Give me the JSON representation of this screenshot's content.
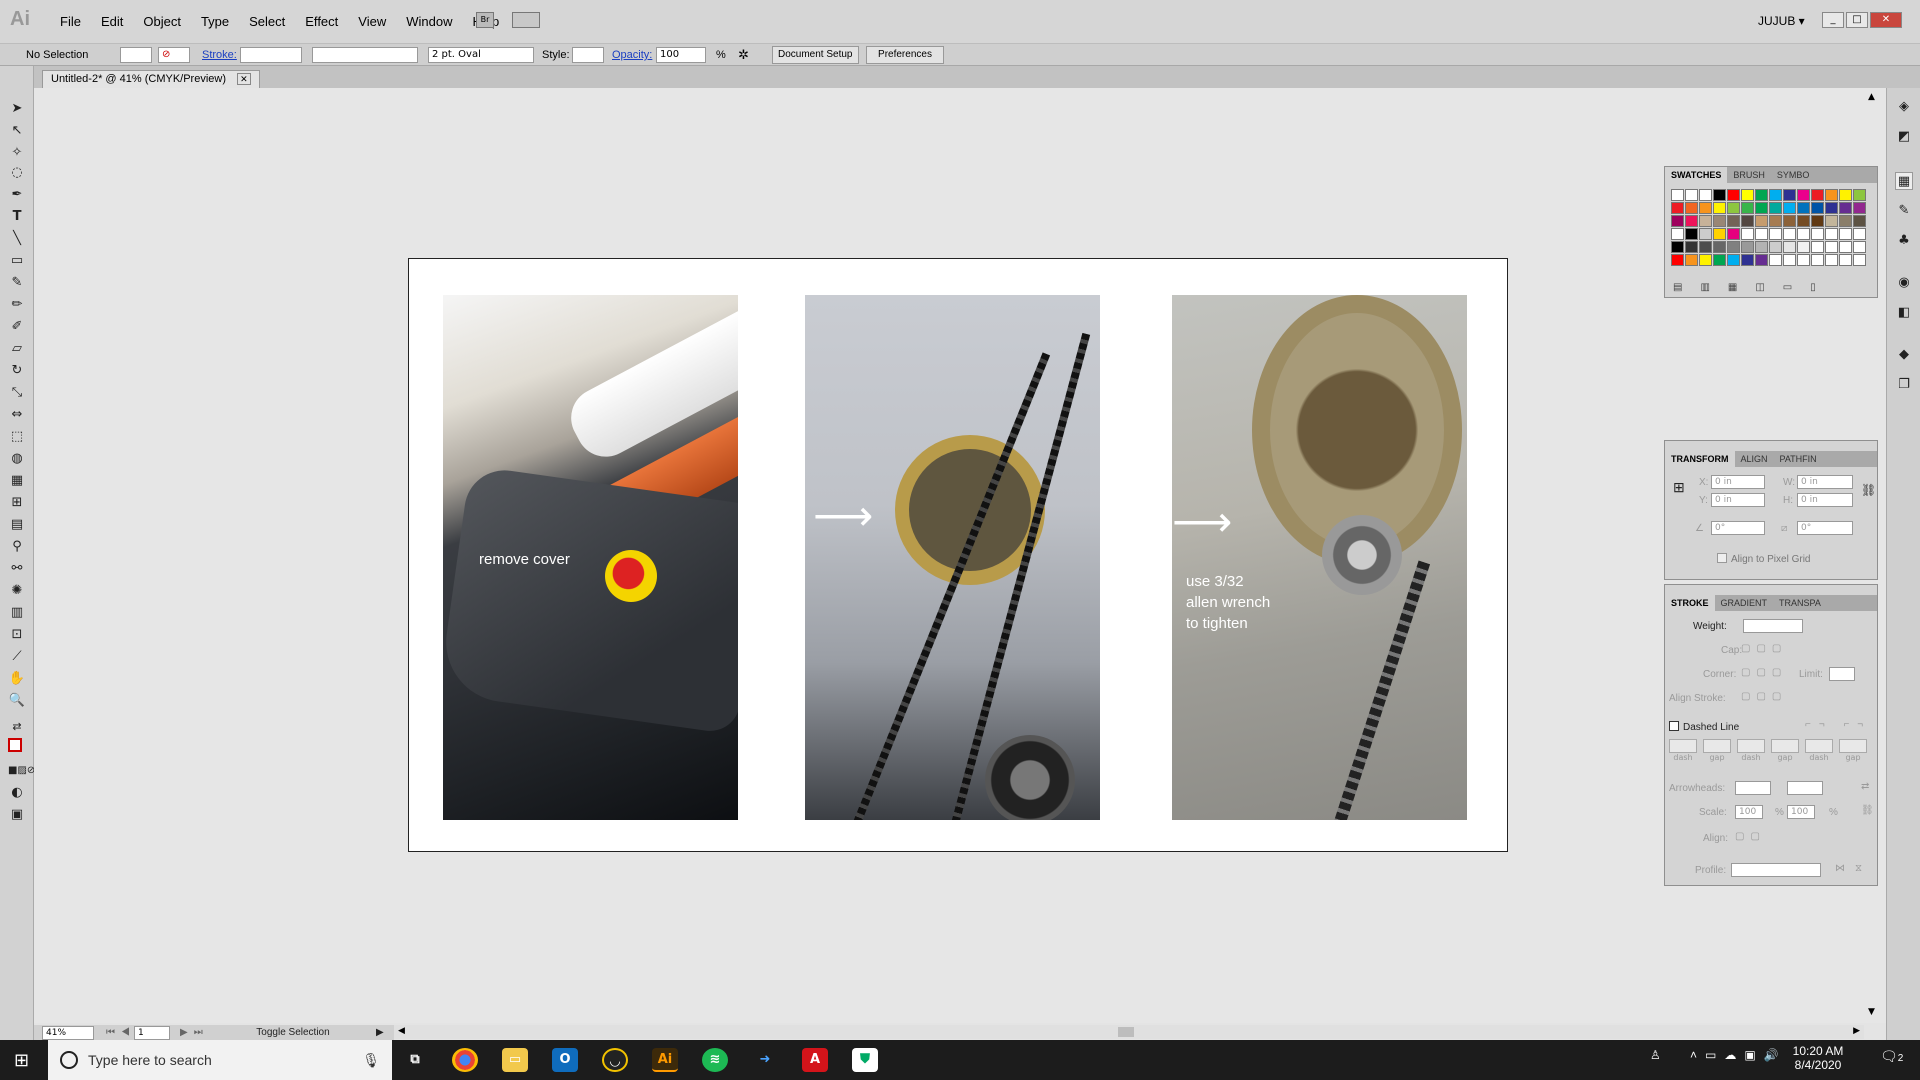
{
  "app": {
    "logo": "Ai",
    "menu": [
      "File",
      "Edit",
      "Object",
      "Type",
      "Select",
      "Effect",
      "View",
      "Window",
      "Help"
    ],
    "bridge_label": "Br",
    "user": "JUJUB"
  },
  "control_bar": {
    "selection": "No Selection",
    "stroke_label": "Stroke:",
    "brush": "2 pt. Oval",
    "style_label": "Style:",
    "opacity_label": "Opacity:",
    "opacity_value": "100",
    "opacity_unit": "%",
    "document_setup": "Document Setup",
    "preferences": "Preferences"
  },
  "document": {
    "tab_title": "Untitled-2* @ 41% (CMYK/Preview)"
  },
  "artboard": {
    "captions": {
      "photo1": "remove cover",
      "photo3_line1": "use 3/32",
      "photo3_line2": "allen wrench",
      "photo3_line3": "to tighten"
    }
  },
  "panels": {
    "swatches_tabs": [
      "SWATCHES",
      "BRUSH",
      "SYMBO"
    ],
    "transform_tabs": [
      "TRANSFORM",
      "ALIGN",
      "PATHFIN"
    ],
    "transform": {
      "x_label": "X:",
      "x_value": "0 in",
      "y_label": "Y:",
      "y_value": "0 in",
      "w_label": "W:",
      "w_value": "0 in",
      "h_label": "H:",
      "h_value": "0 in",
      "angle_value": "0°",
      "shear_value": "0°",
      "align_pixel_grid": "Align to Pixel Grid"
    },
    "stroke_tabs": [
      "STROKE",
      "GRADIENT",
      "TRANSPA"
    ],
    "stroke": {
      "weight_label": "Weight:",
      "cap_label": "Cap:",
      "corner_label": "Corner:",
      "limit_label": "Limit:",
      "align_stroke_label": "Align Stroke:",
      "dashed_line": "Dashed Line",
      "dash_labels": [
        "dash",
        "gap",
        "dash",
        "gap",
        "dash",
        "gap"
      ],
      "arrowheads_label": "Arrowheads:",
      "scale_label": "Scale:",
      "scale_1": "100",
      "scale_2": "100",
      "percent": "%",
      "align_label": "Align:",
      "profile_label": "Profile:"
    },
    "swatch_colors": [
      "#ffffff",
      "#ffffff",
      "#ffffff",
      "#000000",
      "#ff0000",
      "#ffff00",
      "#00a651",
      "#00aeef",
      "#2e3192",
      "#ec008c",
      "#ed1c24",
      "#f7941d",
      "#fff200",
      "#8dc63f",
      "#ed1c24",
      "#f26522",
      "#f7941d",
      "#fff200",
      "#8dc63f",
      "#39b54a",
      "#00a651",
      "#00a99d",
      "#00aeef",
      "#0072bc",
      "#0054a6",
      "#2e3192",
      "#662d91",
      "#92278f",
      "#9e005d",
      "#ed145b",
      "#c7b299",
      "#998675",
      "#736357",
      "#534741",
      "#c69c6d",
      "#a67c52",
      "#8c6239",
      "#754c24",
      "#603913",
      "#c2b59b",
      "#8a7e6a",
      "#5c5243",
      "#ffffff",
      "#000000",
      "#cccccc",
      "#ffd200",
      "#e6007e",
      "#ffffff",
      "#ffffff",
      "#ffffff",
      "#ffffff",
      "#ffffff",
      "#ffffff",
      "#ffffff",
      "#ffffff",
      "#ffffff",
      "#000000",
      "#333333",
      "#4d4d4d",
      "#666666",
      "#808080",
      "#999999",
      "#b3b3b3",
      "#cccccc",
      "#e6e6e6",
      "#f2f2f2",
      "#ffffff",
      "#ffffff",
      "#ffffff",
      "#ffffff",
      "#ff0000",
      "#f7941d",
      "#fff200",
      "#00a651",
      "#00aeef",
      "#2e3192",
      "#662d91",
      "#ffffff",
      "#ffffff",
      "#ffffff",
      "#ffffff",
      "#ffffff",
      "#ffffff",
      "#ffffff"
    ]
  },
  "status": {
    "zoom": "41%",
    "page": "1",
    "toggle_selection": "Toggle Selection"
  },
  "taskbar": {
    "search_placeholder": "Type here to search",
    "time": "10:20 AM",
    "date": "8/4/2020",
    "notifications": "2"
  }
}
